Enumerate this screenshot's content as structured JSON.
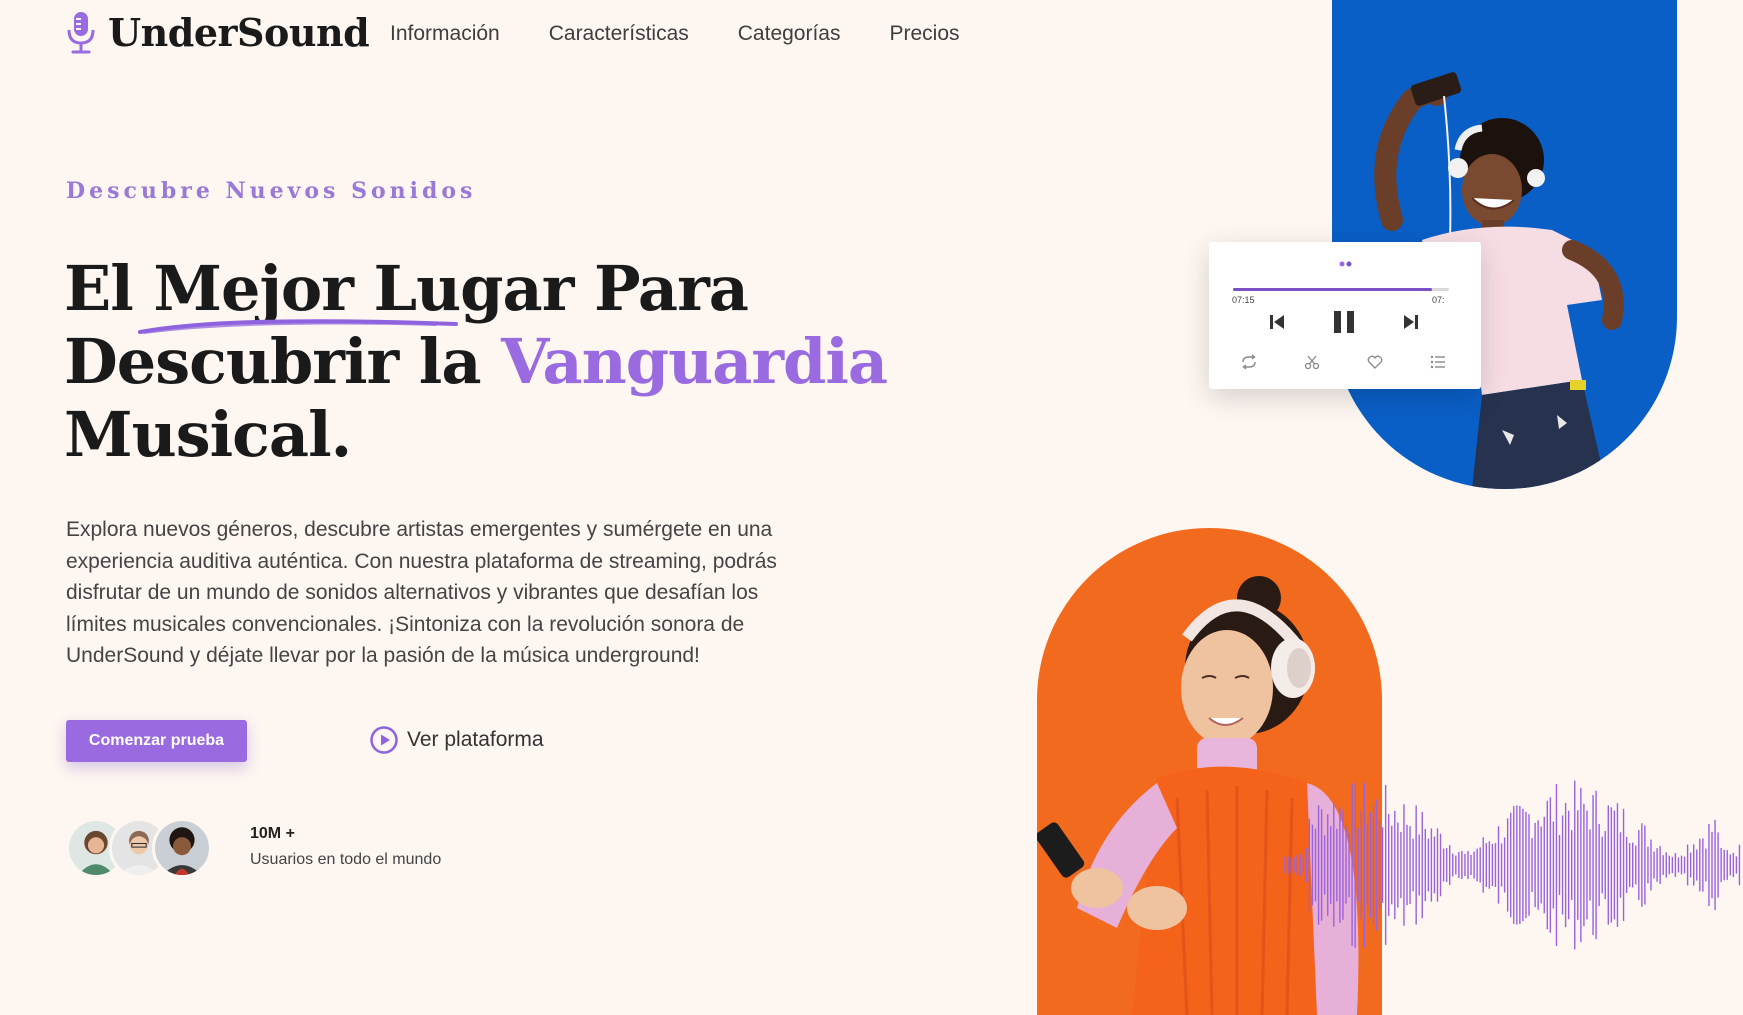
{
  "brand": {
    "name": "UnderSound",
    "icon": "microphone-icon",
    "accent_color": "#9a6be0"
  },
  "nav": {
    "items": [
      "Información",
      "Características",
      "Categorías",
      "Precios"
    ]
  },
  "hero": {
    "eyebrow": "Descubre Nuevos Sonidos",
    "headline_line1": "El Mejor Lugar Para",
    "headline_line2_a": "Descubrir la ",
    "headline_line2_accent": "Vanguardia",
    "headline_line3": "Musical.",
    "description": "Explora nuevos géneros, descubre artistas emergentes y sumérgete en una experiencia auditiva auténtica. Con nuestra plataforma de streaming, podrás disfrutar de un mundo de sonidos alternativos y vibrantes que desafían los límites musicales convencionales. ¡Sintoniza con la revolución sonora de UnderSound y déjate llevar por la pasión de la música underground!",
    "primary_button": "Comenzar prueba",
    "secondary_button": "Ver plataforma"
  },
  "social_proof": {
    "value": "10M +",
    "label": "Usuarios en todo el mundo"
  },
  "player": {
    "time_current": "07:15",
    "time_total": "07:",
    "progress_percent": 92,
    "icons": [
      "previous-icon",
      "pause-icon",
      "next-icon",
      "repeat-icon",
      "scissors-icon",
      "heart-icon",
      "playlist-icon"
    ]
  },
  "colors": {
    "blue_card": "#0a5fc6",
    "orange_card": "#f26a1e",
    "background": "#fdf6f1"
  }
}
